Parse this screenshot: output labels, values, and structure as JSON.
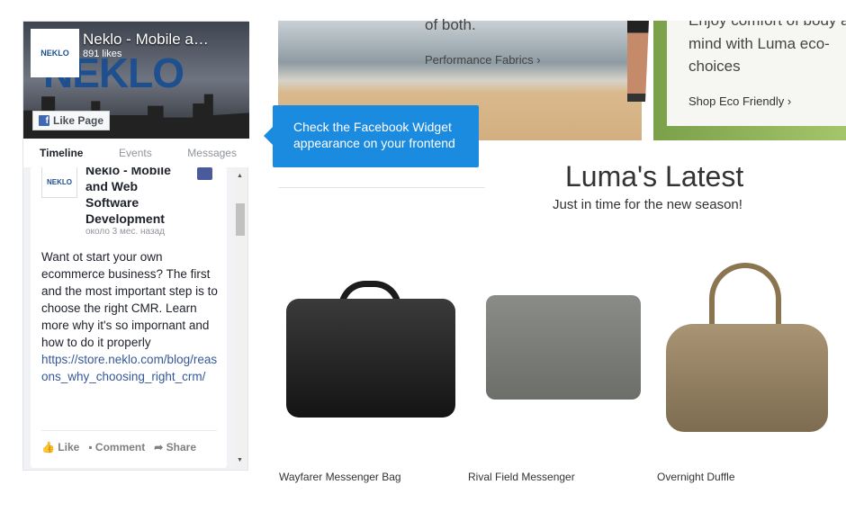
{
  "facebook_widget": {
    "page_name": "Neklo - Mobile a…",
    "likes": "891 likes",
    "logo_text": "NEKLO",
    "like_button": "Like Page",
    "tabs": [
      {
        "label": "Timeline",
        "active": true
      },
      {
        "label": "Events"
      },
      {
        "label": "Messages"
      }
    ],
    "post": {
      "author": "Neklo - Mobile and Web Software Development",
      "time": "около 3 мес. назад",
      "text": "Want ot start your own ecommerce business? The first and the most important step is to choose the right CMR. Learn more why it's so impornant and how to do it properly",
      "link": "https://store.neklo.com/blog/reasons_why_choosing_right_crm/",
      "actions": {
        "like": "Like",
        "comment": "Comment",
        "share": "Share"
      }
    }
  },
  "tooltip": "Check the Facebook Widget appearance on your frontend",
  "banners": {
    "performance": {
      "text": "of both.",
      "link": "Performance Fabrics ›"
    },
    "eco": {
      "text_top": "Enjoy comfort of body and",
      "text": "mind with Luma eco-",
      "text2": "choices",
      "link": "Shop Eco Friendly ›"
    }
  },
  "latest": {
    "title": "Luma's Latest",
    "subtitle": "Just in time for the new season!"
  },
  "products": [
    {
      "name": "Wayfarer Messenger Bag"
    },
    {
      "name": "Rival Field Messenger"
    },
    {
      "name": "Overnight Duffle"
    }
  ],
  "colors": {
    "tooltip": "#1b8be0",
    "facebook": "#4267b2"
  }
}
